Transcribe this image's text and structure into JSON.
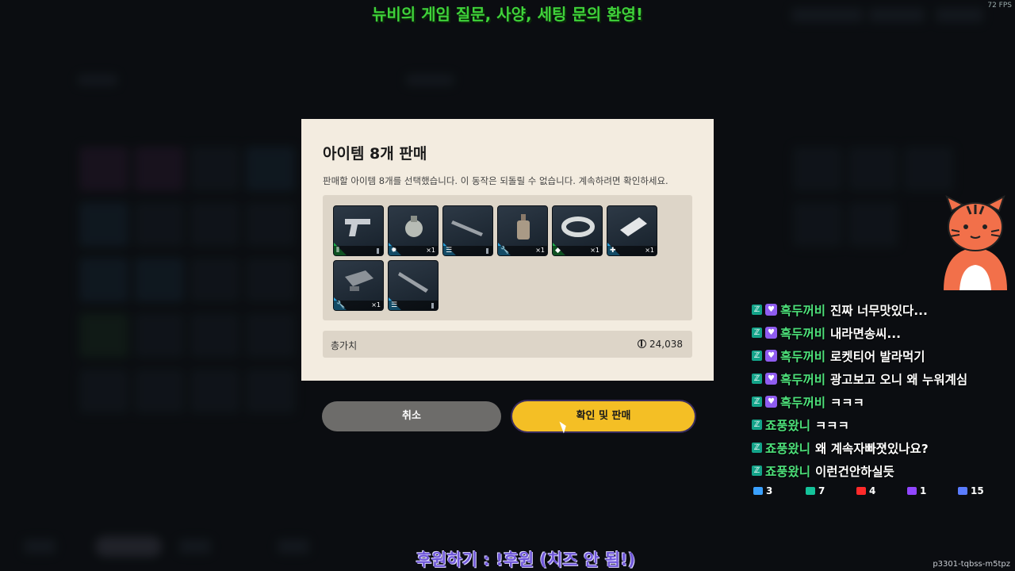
{
  "overlay": {
    "top_banner": "뉴비의 게임 질문, 사양, 세팅 문의 환영!",
    "fps": "72 FPS",
    "bottom_banner": "후원하기 : !후원 (치즈 안 됨!)",
    "stream_id": "p3301-tqbss-m5tpz"
  },
  "dialog": {
    "title": "아이템 8개 판매",
    "description": "판매할 아이템 8개를 선택했습니다. 이 동작은 되돌릴 수 없습니다. 계속하려면 확인하세요.",
    "items": [
      {
        "name": "pistol",
        "rarity": "green",
        "foot_icon": "ammo-icon",
        "qty": ""
      },
      {
        "name": "grenade",
        "rarity": "blue",
        "foot_icon": "explosive-icon",
        "qty": "×1"
      },
      {
        "name": "rifle",
        "rarity": "blue",
        "foot_icon": "list-icon",
        "qty": ""
      },
      {
        "name": "bottle",
        "rarity": "blue",
        "foot_icon": "wrench-icon",
        "qty": "×1"
      },
      {
        "name": "coil",
        "rarity": "green",
        "foot_icon": "gem-icon",
        "qty": "×1"
      },
      {
        "name": "bandage",
        "rarity": "blue",
        "foot_icon": "medkit-icon",
        "qty": "×1"
      },
      {
        "name": "metal-part",
        "rarity": "blue",
        "foot_icon": "wrench-icon",
        "qty": "×1"
      },
      {
        "name": "rifle-2",
        "rarity": "blue",
        "foot_icon": "list-icon",
        "qty": ""
      }
    ],
    "total_label": "총가치",
    "total_value": "24,038",
    "cancel_label": "취소",
    "confirm_label": "확인 및 판매"
  },
  "chat": {
    "messages": [
      {
        "badge": "heart",
        "user": "흑두꺼비",
        "text": "진짜 너무맛있다..."
      },
      {
        "badge": "heart",
        "user": "흑두꺼비",
        "text": "내라면송씨..."
      },
      {
        "badge": "heart",
        "user": "흑두꺼비",
        "text": "로켓티어 발라먹기"
      },
      {
        "badge": "heart",
        "user": "흑두꺼비",
        "text": "광고보고 오니 왜 누워계심"
      },
      {
        "badge": "heart",
        "user": "흑두꺼비",
        "text": "ㅋㅋㅋ"
      },
      {
        "badge": "",
        "user": "죠풍왔니",
        "text": "ㅋㅋㅋ"
      },
      {
        "badge": "",
        "user": "죠풍왔니",
        "text": "왜 계속자빠졋있나요?"
      },
      {
        "badge": "",
        "user": "죠풍왔니",
        "text": "이런건안하실듯"
      }
    ],
    "stats": [
      {
        "icon": "link-icon",
        "color": "#3aa0ff",
        "value": "3"
      },
      {
        "icon": "chzzk-icon",
        "color": "#14c29a",
        "value": "7"
      },
      {
        "icon": "youtube-icon",
        "color": "#ff2a2a",
        "value": "4"
      },
      {
        "icon": "twitch-icon",
        "color": "#9146ff",
        "value": "1"
      },
      {
        "icon": "discord-icon",
        "color": "#5a7cff",
        "value": "15"
      }
    ]
  }
}
